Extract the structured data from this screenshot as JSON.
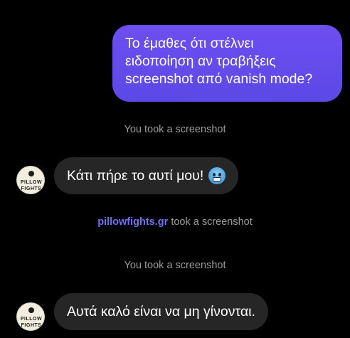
{
  "conversation": {
    "outgoing_message": {
      "lines": [
        "Το έμαθες ότι στέλνει",
        "ειδοποίηση αν τραβήξεις",
        "screenshot από vanish mode?"
      ]
    },
    "notice_1": "You took a screenshot",
    "incoming_message_1": {
      "text": "Κάτι πήρε το αυτί μου!",
      "emoji": "cold-face-emoji"
    },
    "notice_2": {
      "handle": "pillowfights.gr",
      "text": "took a screenshot"
    },
    "notice_3": "You took a screenshot",
    "incoming_message_2": {
      "text": "Αυτά καλό είναι να μη γίνονται."
    }
  },
  "avatar": {
    "logo_lines": [
      "PILLOW",
      "FIGHTS"
    ]
  },
  "colors": {
    "background": "#000000",
    "outgoing_bubble": "#6e4ef0",
    "incoming_bubble": "#262626",
    "notice_text": "#9b9b9b",
    "handle_link": "#6f72f2"
  }
}
